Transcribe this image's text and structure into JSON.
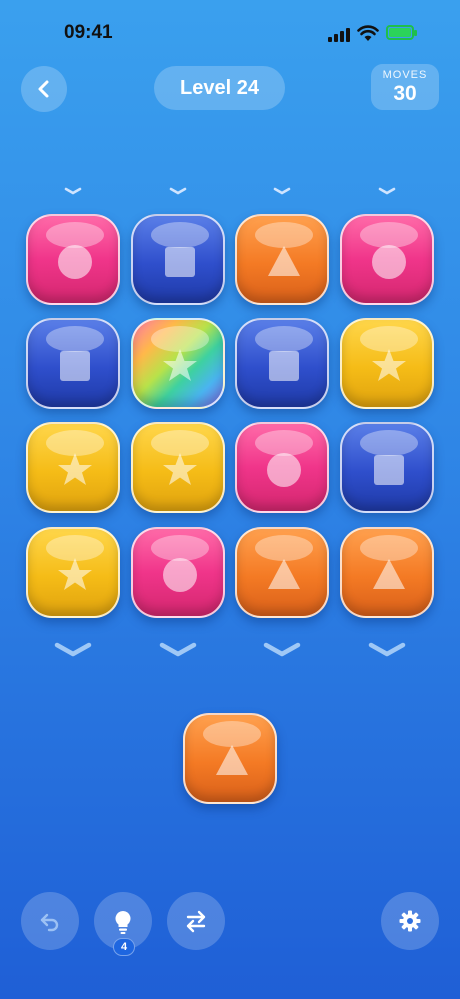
{
  "status_bar": {
    "time": "09:41"
  },
  "header": {
    "level_label": "Level 24",
    "moves_label": "MOVES",
    "moves_value": "30"
  },
  "board": {
    "columns": 4,
    "rows": [
      [
        {
          "color": "pink",
          "shape": "circle"
        },
        {
          "color": "blue",
          "shape": "square"
        },
        {
          "color": "orange",
          "shape": "triangle"
        },
        {
          "color": "pink",
          "shape": "circle"
        }
      ],
      [
        {
          "color": "blue",
          "shape": "square"
        },
        {
          "color": "rainbow",
          "shape": "star"
        },
        {
          "color": "blue",
          "shape": "square"
        },
        {
          "color": "yellow",
          "shape": "star"
        }
      ],
      [
        {
          "color": "yellow",
          "shape": "star"
        },
        {
          "color": "yellow",
          "shape": "star"
        },
        {
          "color": "pink",
          "shape": "circle"
        },
        {
          "color": "blue",
          "shape": "square"
        }
      ],
      [
        {
          "color": "yellow",
          "shape": "star"
        },
        {
          "color": "pink",
          "shape": "circle"
        },
        {
          "color": "orange",
          "shape": "triangle"
        },
        {
          "color": "orange",
          "shape": "triangle"
        }
      ]
    ]
  },
  "next_tile": {
    "color": "orange",
    "shape": "triangle"
  },
  "toolbar": {
    "hint_count": "4",
    "icons": [
      "undo-icon",
      "lightbulb-icon",
      "swap-icon",
      "gear-icon"
    ]
  },
  "colors": {
    "pink": "#f0358a",
    "blue": "#2f4fcc",
    "orange": "#f47a24",
    "yellow": "#f5bc17",
    "battery": "#2bd35a"
  }
}
